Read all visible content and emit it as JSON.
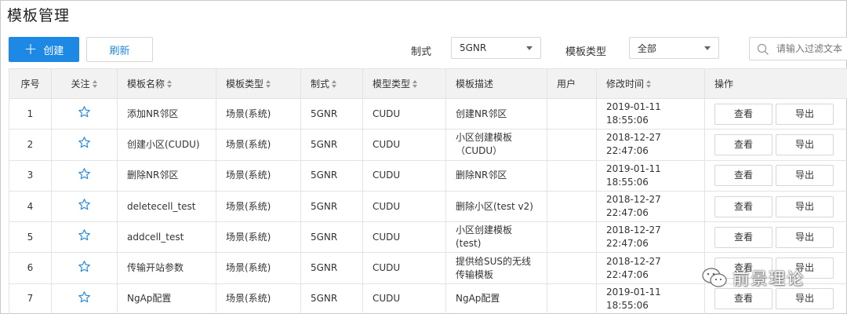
{
  "page_title": "模板管理",
  "toolbar": {
    "create_label": "创建",
    "refresh_label": "刷新",
    "format_label": "制式",
    "format_value": "5GNR",
    "template_type_label": "模板类型",
    "template_type_value": "全部",
    "search_placeholder": "请输入过滤文本"
  },
  "table": {
    "headers": {
      "index": "序号",
      "follow": "关注",
      "name": "模板名称",
      "template_type": "模板类型",
      "format": "制式",
      "model_type": "模型类型",
      "description": "模板描述",
      "user": "用户",
      "modified": "修改时间",
      "actions": "操作"
    },
    "rows": [
      {
        "index": "1",
        "name": "添加NR邻区",
        "template_type": "场景(系统)",
        "format": "5GNR",
        "model_type": "CUDU",
        "description": "创建NR邻区",
        "user": "",
        "modified": "2019-01-11 18:55:06",
        "view": "查看",
        "export": "导出"
      },
      {
        "index": "2",
        "name": "创建小区(CUDU)",
        "template_type": "场景(系统)",
        "format": "5GNR",
        "model_type": "CUDU",
        "description": "小区创建模板\n（CUDU）",
        "user": "",
        "modified": "2018-12-27 22:47:06",
        "view": "查看",
        "export": "导出"
      },
      {
        "index": "3",
        "name": "删除NR邻区",
        "template_type": "场景(系统)",
        "format": "5GNR",
        "model_type": "CUDU",
        "description": "删除NR邻区",
        "user": "",
        "modified": "2019-01-11 18:55:06",
        "view": "查看",
        "export": "导出"
      },
      {
        "index": "4",
        "name": "deletecell_test",
        "template_type": "场景(系统)",
        "format": "5GNR",
        "model_type": "CUDU",
        "description": "删除小区(test v2)",
        "user": "",
        "modified": "2018-12-27 22:47:06",
        "view": "查看",
        "export": "导出"
      },
      {
        "index": "5",
        "name": "addcell_test",
        "template_type": "场景(系统)",
        "format": "5GNR",
        "model_type": "CUDU",
        "description": "小区创建模板\n(test)",
        "user": "",
        "modified": "2018-12-27 22:47:06",
        "view": "查看",
        "export": "导出"
      },
      {
        "index": "6",
        "name": "传输开站参数",
        "template_type": "场景(系统)",
        "format": "5GNR",
        "model_type": "CUDU",
        "description": "提供给SUS的无线\n传输模板",
        "user": "",
        "modified": "2018-12-27 22:47:06",
        "view": "查看",
        "export": "导出"
      },
      {
        "index": "7",
        "name": "NgAp配置",
        "template_type": "场景(系统)",
        "format": "5GNR",
        "model_type": "CUDU",
        "description": "NgAp配置",
        "user": "",
        "modified": "2019-01-11 18:55:06",
        "view": "查看",
        "export": "导出"
      }
    ]
  },
  "watermark": {
    "text": "前景理论"
  },
  "colors": {
    "primary": "#1e88e5",
    "star": "#1e88e5",
    "header_bg": "#f2f2f2",
    "border": "#e3e3e3"
  },
  "icons": {
    "create": "plus-icon",
    "search": "search-icon",
    "follow": "star-outline-icon",
    "sort": "sort-caret-icon",
    "dropdown": "chevron-down-icon",
    "watermark": "wechat-icon"
  }
}
